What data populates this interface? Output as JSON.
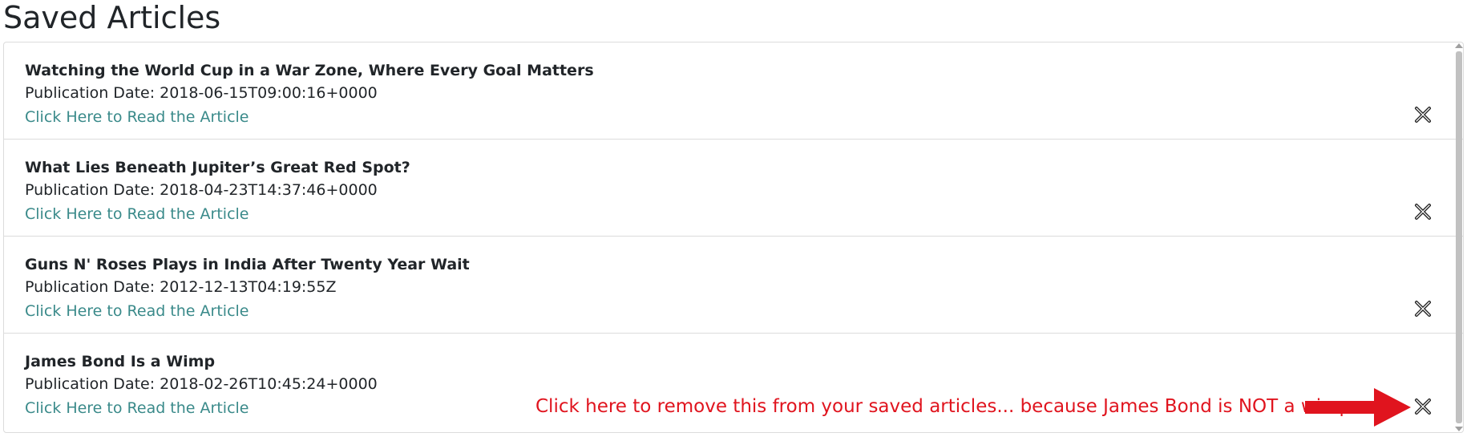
{
  "page": {
    "title": "Saved Articles"
  },
  "articles": [
    {
      "title": "Watching the World Cup in a War Zone, Where Every Goal Matters",
      "date_label": "Publication Date:",
      "date": "2018-06-15T09:00:16+0000",
      "link_text": "Click Here to Read the Article"
    },
    {
      "title": "What Lies Beneath Jupiter’s Great Red Spot?",
      "date_label": "Publication Date:",
      "date": "2018-04-23T14:37:46+0000",
      "link_text": "Click Here to Read the Article"
    },
    {
      "title": "Guns N' Roses Plays in India After Twenty Year Wait",
      "date_label": "Publication Date:",
      "date": "2012-12-13T04:19:55Z",
      "link_text": "Click Here to Read the Article"
    },
    {
      "title": "James Bond Is a Wimp",
      "date_label": "Publication Date:",
      "date": "2018-02-26T10:45:24+0000",
      "link_text": "Click Here to Read the Article"
    }
  ],
  "annotation": {
    "text": "Click here to remove this from your saved articles... because James Bond is NOT a wimp.",
    "color": "#e0141e"
  },
  "icons": {
    "remove": "close-x-icon",
    "arrow": "arrow-right-icon"
  },
  "colors": {
    "link": "#3a8a8a",
    "border": "#dcdcdc",
    "text": "#212529"
  }
}
